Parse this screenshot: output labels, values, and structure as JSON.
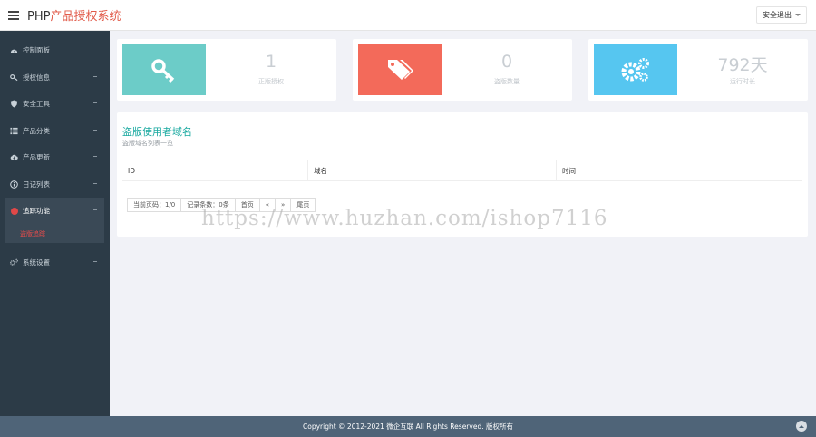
{
  "header": {
    "brand_prefix": "PHP",
    "brand_suffix": "产品授权系统",
    "user_menu_label": "安全退出"
  },
  "sidebar": {
    "items": [
      {
        "label": "控制面板",
        "icon": "dashboard-icon"
      },
      {
        "label": "授权信息",
        "icon": "key-icon"
      },
      {
        "label": "安全工具",
        "icon": "shield-icon"
      },
      {
        "label": "产品分类",
        "icon": "list-icon"
      },
      {
        "label": "产品更新",
        "icon": "cloud-download-icon"
      },
      {
        "label": "日记列表",
        "icon": "info-icon"
      },
      {
        "label": "追踪功能",
        "icon": "target-icon"
      },
      {
        "label": "系统设置",
        "icon": "gears-icon"
      }
    ],
    "submenu_label": "盗版追踪"
  },
  "stats": [
    {
      "value": "1",
      "label": "正版授权",
      "color": "#6cccc8",
      "icon": "key-icon"
    },
    {
      "value": "0",
      "label": "盗版数量",
      "color": "#f36a5a",
      "icon": "tags-icon"
    },
    {
      "value": "792天",
      "label": "运行时长",
      "color": "#56c6f0",
      "icon": "gears-icon"
    }
  ],
  "panel": {
    "title": "盗版使用者域名",
    "subtitle": "盗版域名列表一览",
    "columns": [
      "ID",
      "域名",
      "时间"
    ]
  },
  "pagination": {
    "current_page": "当前页码：1/0",
    "record_count": "记录条数：0条",
    "first": "首页",
    "prev": "«",
    "next": "»",
    "last": "尾页"
  },
  "watermark": "https://www.huzhan.com/ishop7116",
  "footer": {
    "copyright": "Copyright © 2012-2021 微企互联 All Rights Reserved. 版权所有"
  }
}
